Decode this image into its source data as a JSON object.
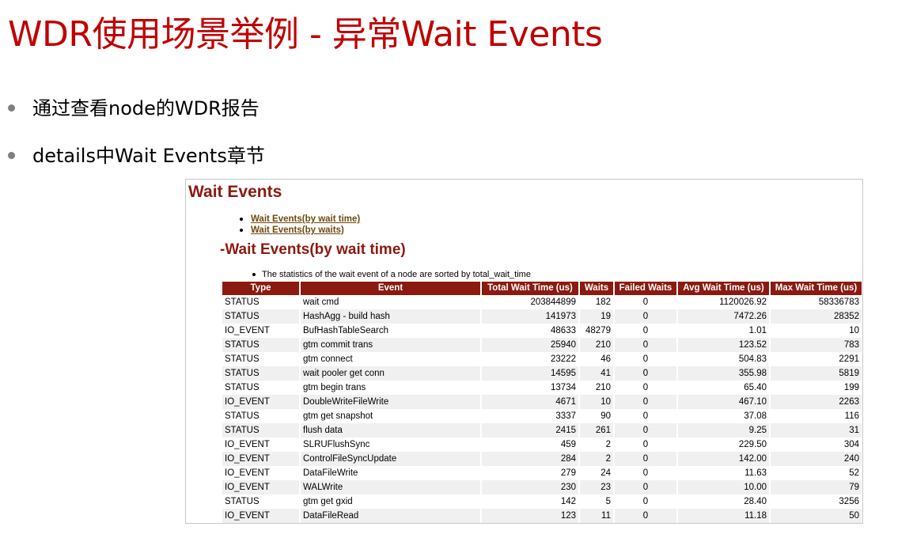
{
  "slide": {
    "title": "WDR使用场景举例 - 异常Wait Events",
    "bullets": [
      "通过查看node的WDR报告",
      "details中Wait Events章节"
    ]
  },
  "report": {
    "heading": "Wait Events",
    "toc": [
      "Wait Events(by wait time)",
      "Wait Events(by waits)"
    ],
    "subheading": "-Wait Events(by wait time)",
    "note": "The statistics of the wait event of a node are sorted by total_wait_time",
    "table": {
      "headers": [
        "Type",
        "Event",
        "Total Wait Time (us)",
        "Waits",
        "Failed Waits",
        "Avg Wait Time (us)",
        "Max Wait Time (us)"
      ],
      "rows": [
        [
          "STATUS",
          "wait cmd",
          "203844899",
          "182",
          "0",
          "1120026.92",
          "58336783"
        ],
        [
          "STATUS",
          "HashAgg - build hash",
          "141973",
          "19",
          "0",
          "7472.26",
          "28352"
        ],
        [
          "IO_EVENT",
          "BufHashTableSearch",
          "48633",
          "48279",
          "0",
          "1.01",
          "10"
        ],
        [
          "STATUS",
          "gtm commit trans",
          "25940",
          "210",
          "0",
          "123.52",
          "783"
        ],
        [
          "STATUS",
          "gtm connect",
          "23222",
          "46",
          "0",
          "504.83",
          "2291"
        ],
        [
          "STATUS",
          "wait pooler get conn",
          "14595",
          "41",
          "0",
          "355.98",
          "5819"
        ],
        [
          "STATUS",
          "gtm begin trans",
          "13734",
          "210",
          "0",
          "65.40",
          "199"
        ],
        [
          "IO_EVENT",
          "DoubleWriteFileWrite",
          "4671",
          "10",
          "0",
          "467.10",
          "2263"
        ],
        [
          "STATUS",
          "gtm get snapshot",
          "3337",
          "90",
          "0",
          "37.08",
          "116"
        ],
        [
          "STATUS",
          "flush data",
          "2415",
          "261",
          "0",
          "9.25",
          "31"
        ],
        [
          "IO_EVENT",
          "SLRUFlushSync",
          "459",
          "2",
          "0",
          "229.50",
          "304"
        ],
        [
          "IO_EVENT",
          "ControlFileSyncUpdate",
          "284",
          "2",
          "0",
          "142.00",
          "240"
        ],
        [
          "IO_EVENT",
          "DataFileWrite",
          "279",
          "24",
          "0",
          "11.63",
          "52"
        ],
        [
          "IO_EVENT",
          "WALWrite",
          "230",
          "23",
          "0",
          "10.00",
          "79"
        ],
        [
          "STATUS",
          "gtm get gxid",
          "142",
          "5",
          "0",
          "28.40",
          "3256"
        ],
        [
          "IO_EVENT",
          "DataFileRead",
          "123",
          "11",
          "0",
          "11.18",
          "50"
        ]
      ]
    }
  },
  "colors": {
    "title": "#c00000",
    "report_accent": "#8b1a10",
    "bullet_dot": "#7f7f7f"
  }
}
